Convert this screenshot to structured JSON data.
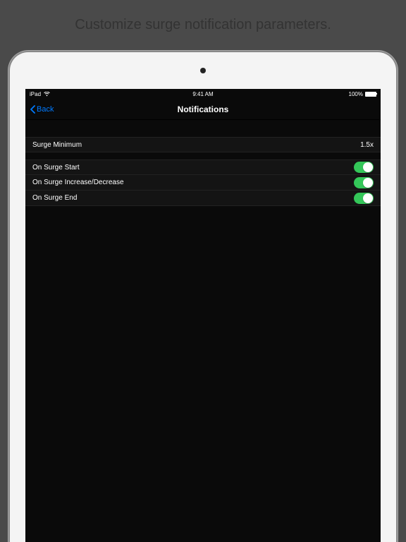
{
  "caption": "Customize surge notification parameters.",
  "status": {
    "carrier": "iPad",
    "time": "9:41 AM",
    "battery_pct": "100%"
  },
  "nav": {
    "back": "Back",
    "title": "Notifications"
  },
  "surge_min": {
    "label": "Surge Minimum",
    "value": "1.5x"
  },
  "toggles": [
    {
      "label": "On Surge Start",
      "on": true
    },
    {
      "label": "On Surge Increase/Decrease",
      "on": true
    },
    {
      "label": "On Surge End",
      "on": true
    }
  ]
}
